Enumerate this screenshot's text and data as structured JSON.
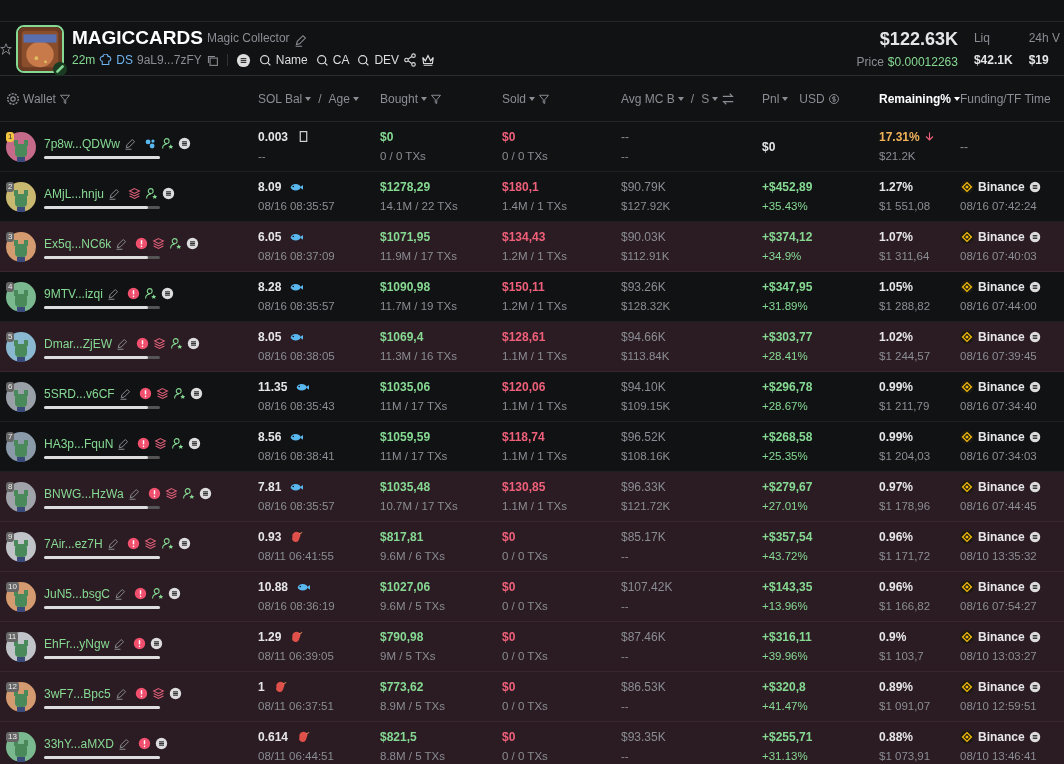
{
  "token": {
    "name": "MAGICCARDS",
    "subtitle": "Magic Collector",
    "age": "22m",
    "dex": "DS",
    "address": "9aL9...7zFY",
    "searches": [
      "Name",
      "CA",
      "DEV"
    ]
  },
  "stats": {
    "market_cap": "$122.63K",
    "price_label": "Price",
    "price": "$0.00012263",
    "items": [
      {
        "label": "Liq",
        "value": "$42.1K"
      },
      {
        "label": "24h V",
        "value": "$19"
      }
    ]
  },
  "columns": [
    {
      "label": "Wallet",
      "kind": "wallet",
      "selected": false
    },
    {
      "label": "SOL Bal",
      "sep": "/",
      "label2": "Age",
      "kind": "pair",
      "selected": false
    },
    {
      "label": "Bought",
      "kind": "filter",
      "selected": false
    },
    {
      "label": "Sold",
      "kind": "filter",
      "selected": false
    },
    {
      "label": "Avg MC B",
      "sep": "/",
      "label2": "S",
      "kind": "swap",
      "selected": false
    },
    {
      "label": "Pnl",
      "label2": "USD",
      "kind": "currency",
      "selected": false
    },
    {
      "label": "Remaining%",
      "kind": "sort",
      "selected": true
    },
    {
      "label": "Funding/TF Time",
      "kind": "plain",
      "selected": false
    }
  ],
  "rows": [
    {
      "rank": "1",
      "wallet": "7p8w...QDWw",
      "level": 1,
      "bubbles": true,
      "warning": false,
      "stack": false,
      "user_star": true,
      "coin": true,
      "sol": {
        "value": "0.003",
        "kind": "box"
      },
      "age": "--",
      "bought": "$0",
      "bought_sub": "0 / 0 TXs",
      "sold": "$0",
      "sold_sub": "0 / 0 TXs",
      "mc_b": "--",
      "mc_s": "--",
      "pnl": "$0",
      "remaining": "17.31%",
      "falling": true,
      "remaining_usd": "$21.2K",
      "funding_time": "--",
      "highlighted": false
    },
    {
      "rank": "2",
      "wallet": "AMjL...hnju",
      "level": 0.9,
      "bubbles": false,
      "warning": false,
      "stack": true,
      "user_star": true,
      "coin": true,
      "sol": {
        "value": "8.09",
        "kind": "fish"
      },
      "age": "08/16 08:35:57",
      "bought": "$1278,29",
      "bought_sub": "14.1M / 22 TXs",
      "sold": "$180,1",
      "sold_sub": "1.4M / 1 TXs",
      "mc_b": "$90.79K",
      "mc_s": "$127.92K",
      "pnl": "+$452,89",
      "pnl_pct": "+35.43%",
      "remaining": "1.27%",
      "falling": false,
      "remaining_usd": "$1 551,08",
      "funding": "Binance",
      "funding_time": "08/16 07:42:24",
      "highlighted": false
    },
    {
      "rank": "3",
      "wallet": "Ex5q...NC6k",
      "level": 0.9,
      "bubbles": false,
      "warning": true,
      "stack": true,
      "user_star": true,
      "coin": true,
      "sol": {
        "value": "6.05",
        "kind": "fish"
      },
      "age": "08/16 08:37:09",
      "bought": "$1071,95",
      "bought_sub": "11.9M / 17 TXs",
      "sold": "$134,43",
      "sold_sub": "1.2M / 1 TXs",
      "mc_b": "$90.03K",
      "mc_s": "$112.91K",
      "pnl": "+$374,12",
      "pnl_pct": "+34.9%",
      "remaining": "1.07%",
      "falling": false,
      "remaining_usd": "$1 311,64",
      "funding": "Binance",
      "funding_time": "08/16 07:40:03",
      "highlighted": true
    },
    {
      "rank": "4",
      "wallet": "9MTV...izqi",
      "level": 0.9,
      "bubbles": false,
      "warning": true,
      "stack": false,
      "user_star": true,
      "coin": true,
      "sol": {
        "value": "8.28",
        "kind": "fish"
      },
      "age": "08/16 08:35:57",
      "bought": "$1090,98",
      "bought_sub": "11.7M / 19 TXs",
      "sold": "$150,11",
      "sold_sub": "1.2M / 1 TXs",
      "mc_b": "$93.26K",
      "mc_s": "$128.32K",
      "pnl": "+$347,95",
      "pnl_pct": "+31.89%",
      "remaining": "1.05%",
      "falling": false,
      "remaining_usd": "$1 288,82",
      "funding": "Binance",
      "funding_time": "08/16 07:44:00",
      "highlighted": false
    },
    {
      "rank": "5",
      "wallet": "Dmar...ZjEW",
      "level": 0.9,
      "bubbles": false,
      "warning": true,
      "stack": true,
      "user_star": true,
      "coin": true,
      "sol": {
        "value": "8.05",
        "kind": "fish"
      },
      "age": "08/16 08:38:05",
      "bought": "$1069,4",
      "bought_sub": "11.3M / 16 TXs",
      "sold": "$128,61",
      "sold_sub": "1.1M / 1 TXs",
      "mc_b": "$94.66K",
      "mc_s": "$113.84K",
      "pnl": "+$303,77",
      "pnl_pct": "+28.41%",
      "remaining": "1.02%",
      "falling": false,
      "remaining_usd": "$1 244,57",
      "funding": "Binance",
      "funding_time": "08/16 07:39:45",
      "highlighted": true
    },
    {
      "rank": "6",
      "wallet": "5SRD...v6CF",
      "level": 0.9,
      "bubbles": false,
      "warning": true,
      "stack": true,
      "user_star": true,
      "coin": true,
      "sol": {
        "value": "11.35",
        "kind": "fish"
      },
      "age": "08/16 08:35:43",
      "bought": "$1035,06",
      "bought_sub": "11M / 17 TXs",
      "sold": "$120,06",
      "sold_sub": "1.1M / 1 TXs",
      "mc_b": "$94.10K",
      "mc_s": "$109.15K",
      "pnl": "+$296,78",
      "pnl_pct": "+28.67%",
      "remaining": "0.99%",
      "falling": false,
      "remaining_usd": "$1 211,79",
      "funding": "Binance",
      "funding_time": "08/16 07:34:40",
      "highlighted": false
    },
    {
      "rank": "7",
      "wallet": "HA3p...FquN",
      "level": 0.9,
      "bubbles": false,
      "warning": true,
      "stack": true,
      "user_star": true,
      "coin": true,
      "sol": {
        "value": "8.56",
        "kind": "fish"
      },
      "age": "08/16 08:38:41",
      "bought": "$1059,59",
      "bought_sub": "11M / 17 TXs",
      "sold": "$118,74",
      "sold_sub": "1.1M / 1 TXs",
      "mc_b": "$96.52K",
      "mc_s": "$108.16K",
      "pnl": "+$268,58",
      "pnl_pct": "+25.35%",
      "remaining": "0.99%",
      "falling": false,
      "remaining_usd": "$1 204,03",
      "funding": "Binance",
      "funding_time": "08/16 07:34:03",
      "highlighted": false
    },
    {
      "rank": "8",
      "wallet": "BNWG...HzWa",
      "level": 0.9,
      "bubbles": false,
      "warning": true,
      "stack": true,
      "user_star": true,
      "coin": true,
      "sol": {
        "value": "7.81",
        "kind": "fish"
      },
      "age": "08/16 08:35:57",
      "bought": "$1035,48",
      "bought_sub": "10.7M / 17 TXs",
      "sold": "$130,85",
      "sold_sub": "1.1M / 1 TXs",
      "mc_b": "$96.33K",
      "mc_s": "$121.72K",
      "pnl": "+$279,67",
      "pnl_pct": "+27.01%",
      "remaining": "0.97%",
      "falling": false,
      "remaining_usd": "$1 178,96",
      "funding": "Binance",
      "funding_time": "08/16 07:44:45",
      "highlighted": true
    },
    {
      "rank": "9",
      "wallet": "7Air...ez7H",
      "level": 1,
      "bubbles": false,
      "warning": true,
      "stack": true,
      "user_star": true,
      "coin": true,
      "sol": {
        "value": "0.93",
        "kind": "shrimp"
      },
      "age": "08/11 06:41:55",
      "bought": "$817,81",
      "bought_sub": "9.6M / 6 TXs",
      "sold": "$0",
      "sold_sub": "0 / 0 TXs",
      "mc_b": "$85.17K",
      "mc_s": "--",
      "pnl": "+$357,54",
      "pnl_pct": "+43.72%",
      "remaining": "0.96%",
      "falling": false,
      "remaining_usd": "$1 171,72",
      "funding": "Binance",
      "funding_time": "08/10 13:35:32",
      "highlighted": true
    },
    {
      "rank": "10",
      "wallet": "JuN5...bsgC",
      "level": 1,
      "bubbles": false,
      "warning": true,
      "stack": false,
      "user_star": true,
      "coin": true,
      "sol": {
        "value": "10.88",
        "kind": "fish"
      },
      "age": "08/16 08:36:19",
      "bought": "$1027,06",
      "bought_sub": "9.6M / 5 TXs",
      "sold": "$0",
      "sold_sub": "0 / 0 TXs",
      "mc_b": "$107.42K",
      "mc_s": "--",
      "pnl": "+$143,35",
      "pnl_pct": "+13.96%",
      "remaining": "0.96%",
      "falling": false,
      "remaining_usd": "$1 166,82",
      "funding": "Binance",
      "funding_time": "08/16 07:54:27",
      "highlighted": true
    },
    {
      "rank": "11",
      "wallet": "EhFr...yNgw",
      "level": 1,
      "bubbles": false,
      "warning": true,
      "stack": false,
      "user_star": false,
      "coin": true,
      "sol": {
        "value": "1.29",
        "kind": "shrimp"
      },
      "age": "08/11 06:39:05",
      "bought": "$790,98",
      "bought_sub": "9M / 5 TXs",
      "sold": "$0",
      "sold_sub": "0 / 0 TXs",
      "mc_b": "$87.46K",
      "mc_s": "--",
      "pnl": "+$316,11",
      "pnl_pct": "+39.96%",
      "remaining": "0.9%",
      "falling": false,
      "remaining_usd": "$1 103,7",
      "funding": "Binance",
      "funding_time": "08/10 13:03:27",
      "highlighted": true
    },
    {
      "rank": "12",
      "wallet": "3wF7...Bpc5",
      "level": 1,
      "bubbles": false,
      "warning": true,
      "stack": true,
      "user_star": false,
      "coin": true,
      "sol": {
        "value": "1",
        "kind": "shrimp"
      },
      "age": "08/11 06:37:51",
      "bought": "$773,62",
      "bought_sub": "8.9M / 5 TXs",
      "sold": "$0",
      "sold_sub": "0 / 0 TXs",
      "mc_b": "$86.53K",
      "mc_s": "--",
      "pnl": "+$320,8",
      "pnl_pct": "+41.47%",
      "remaining": "0.89%",
      "falling": false,
      "remaining_usd": "$1 091,07",
      "funding": "Binance",
      "funding_time": "08/10 12:59:51",
      "highlighted": true
    },
    {
      "rank": "13",
      "wallet": "33hY...aMXD",
      "level": 1,
      "bubbles": false,
      "warning": true,
      "stack": false,
      "user_star": false,
      "coin": true,
      "sol": {
        "value": "0.614",
        "kind": "shrimp"
      },
      "age": "08/11 06:44:51",
      "bought": "$821,5",
      "bought_sub": "8.8M / 5 TXs",
      "sold": "$0",
      "sold_sub": "0 / 0 TXs",
      "mc_b": "$93.35K",
      "mc_s": "--",
      "pnl": "+$255,71",
      "pnl_pct": "+31.13%",
      "remaining": "0.88%",
      "falling": false,
      "remaining_usd": "$1 073,91",
      "funding": "Binance",
      "funding_time": "08/10 13:46:41",
      "highlighted": true
    }
  ]
}
